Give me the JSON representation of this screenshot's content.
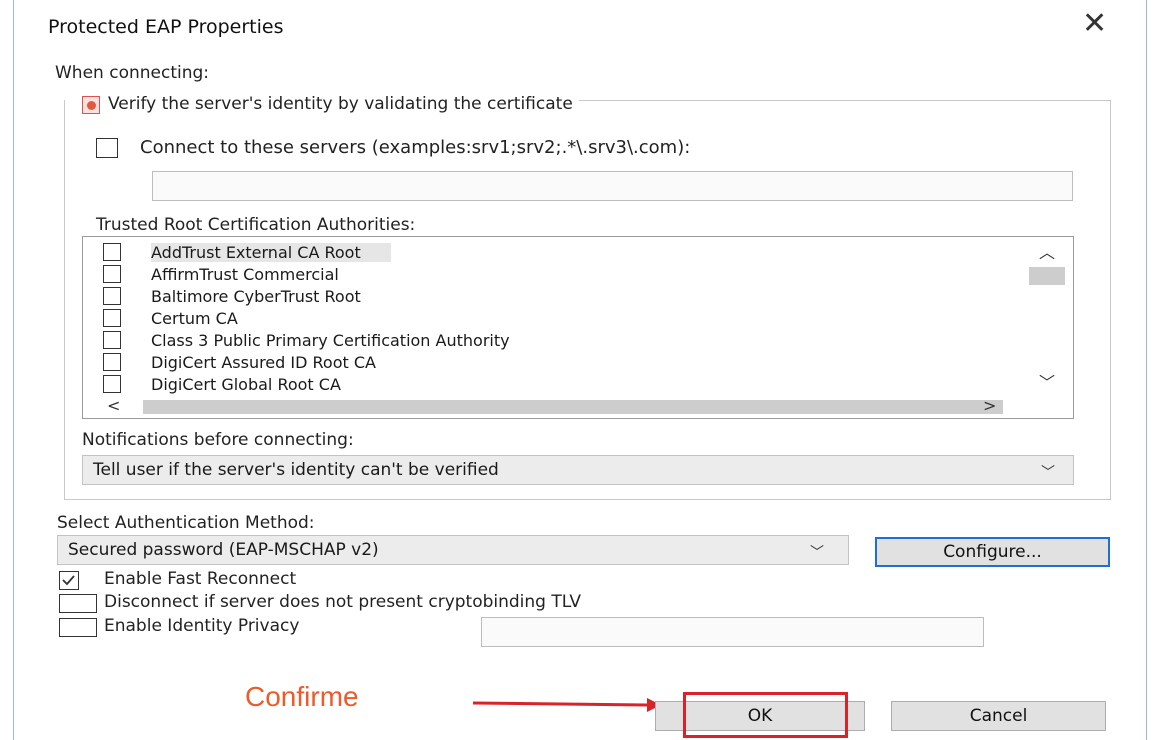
{
  "window": {
    "title": "Protected EAP Properties"
  },
  "connect": {
    "when_connecting": "When connecting:",
    "verify_label": "Verify the server's identity by validating the certificate",
    "connect_servers_label": "Connect to these servers (examples:srv1;srv2;.*\\.srv3\\.com):",
    "servers_value": ""
  },
  "trusted": {
    "label": "Trusted Root Certification Authorities:",
    "items": [
      "AddTrust External CA Root",
      "AffirmTrust Commercial",
      "Baltimore CyberTrust Root",
      "Certum CA",
      "Class 3 Public Primary Certification Authority",
      "DigiCert Assured ID Root CA",
      "DigiCert Global Root CA"
    ]
  },
  "notifications": {
    "label": "Notifications before connecting:",
    "value": "Tell user if the server's identity can't be verified"
  },
  "auth": {
    "label": "Select Authentication Method:",
    "value": "Secured password (EAP-MSCHAP v2)",
    "configure_label": "Configure..."
  },
  "options": {
    "fast_reconnect": "Enable Fast Reconnect",
    "fast_reconnect_checked": true,
    "disconnect": "Disconnect if server does not present cryptobinding TLV",
    "disconnect_checked": false,
    "identity_privacy": "Enable Identity Privacy",
    "identity_privacy_checked": false,
    "identity_value": ""
  },
  "buttons": {
    "ok": "OK",
    "cancel": "Cancel"
  },
  "annotation": {
    "text": "Confirme",
    "color": "#ef5a28",
    "highlight_color": "#d8232a"
  }
}
